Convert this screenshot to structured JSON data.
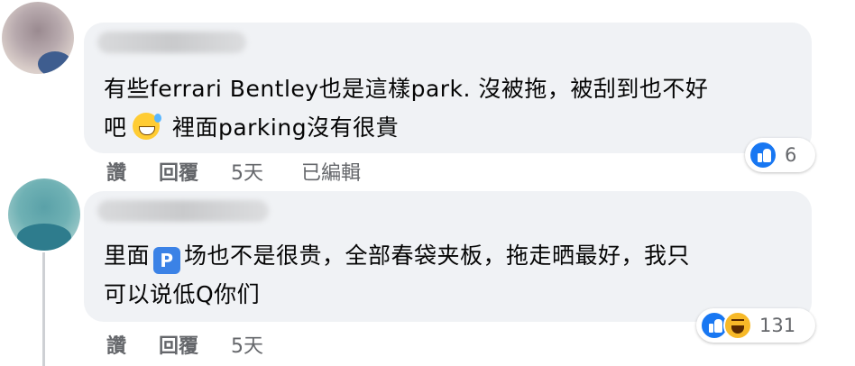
{
  "comments": [
    {
      "text_line1_part1": "有些ferrari Bentley也是這樣park. 沒被拖，被刮到也不好",
      "text_line2_part1": "吧",
      "text_line2_part2": " 裡面parking沒有很貴",
      "emoji": "grinning-face-with-sweat-icon",
      "reaction_count": "6",
      "actions": {
        "like": "讚",
        "reply": "回覆",
        "time": "5天",
        "edited": "已編輯"
      }
    },
    {
      "text_line1_part1": "里面",
      "badge": "P",
      "text_line1_part2": "场也不是很贵，全部春袋夹板，拖走晒最好，我只",
      "text_line2": "可以说低Q你们",
      "reaction_count": "131",
      "actions": {
        "like": "讚",
        "reply": "回覆",
        "time": "5天"
      }
    }
  ],
  "colors": {
    "bubble": "#f0f2f5",
    "meta_text": "#65676b",
    "like_blue": "#1877f2",
    "haha_yellow": "#f7b928"
  }
}
